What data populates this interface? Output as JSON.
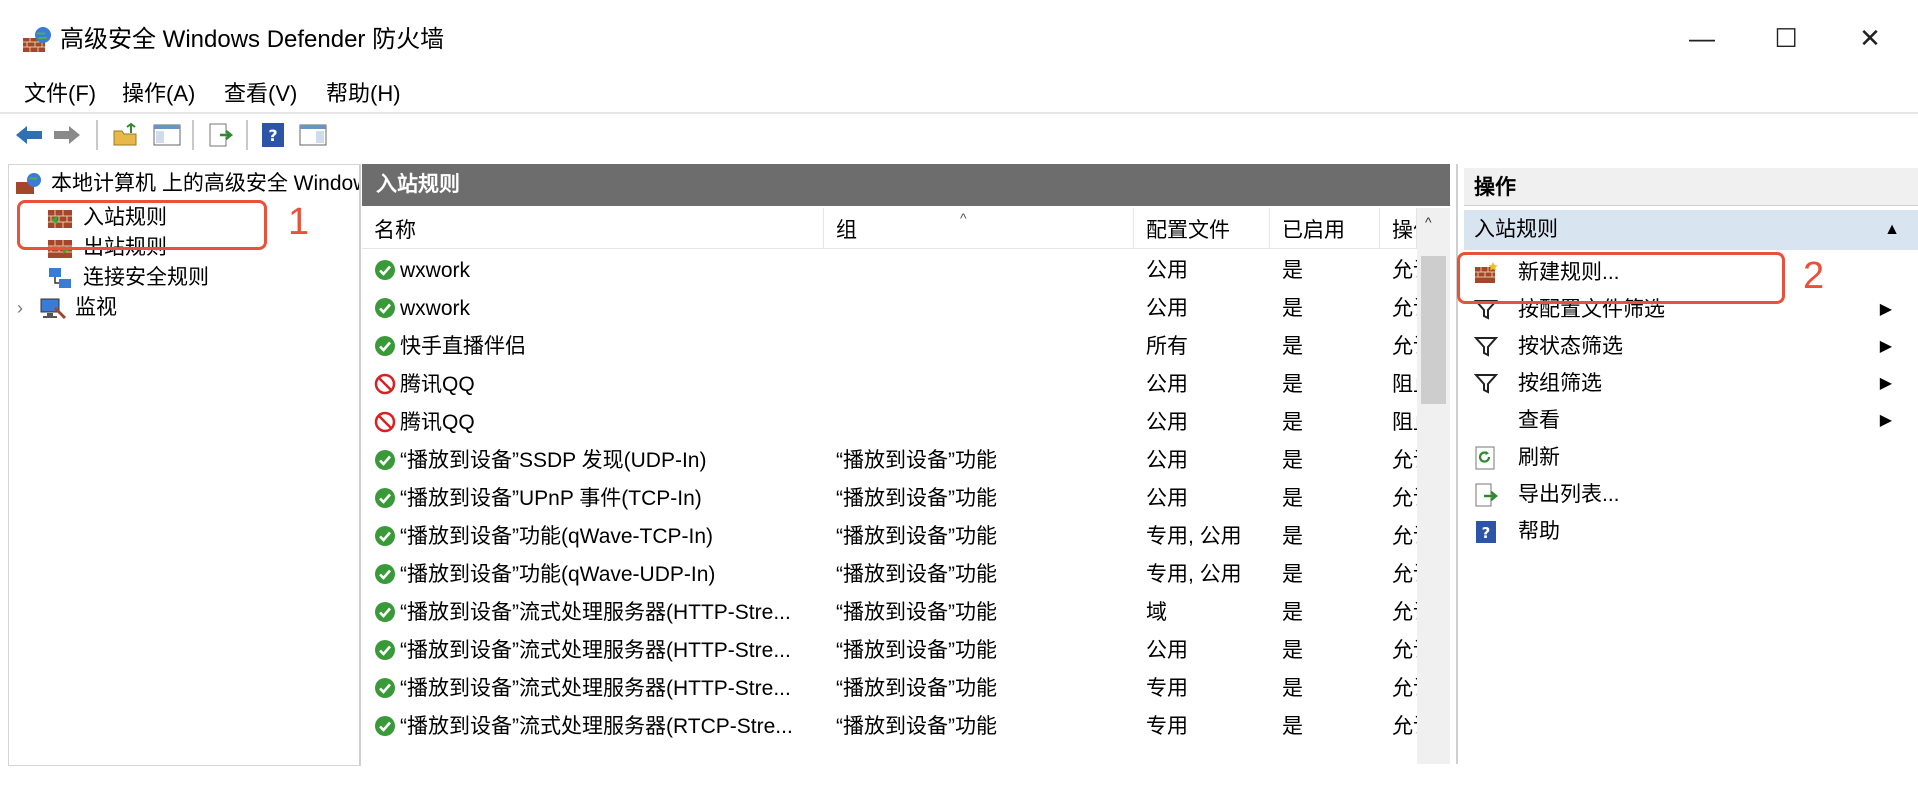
{
  "window": {
    "title": "高级安全 Windows Defender 防火墙",
    "minimize": "—",
    "maximize": "☐",
    "close": "✕"
  },
  "menu": [
    "文件(F)",
    "操作(A)",
    "查看(V)",
    "帮助(H)"
  ],
  "tree": {
    "root": "本地计算机 上的高级安全 Windows Defender 防火墙",
    "items": [
      "入站规则",
      "出站规则",
      "连接安全规则",
      "监视"
    ]
  },
  "center": {
    "header": "入站规则",
    "columns": [
      "名称",
      "组",
      "配置文件",
      "已启用",
      "操作"
    ],
    "rows": [
      {
        "status": "allow",
        "name": "wxwork",
        "group": "",
        "profile": "公用",
        "enabled": "是",
        "action": "允许"
      },
      {
        "status": "allow",
        "name": "wxwork",
        "group": "",
        "profile": "公用",
        "enabled": "是",
        "action": "允许"
      },
      {
        "status": "allow",
        "name": "快手直播伴侣",
        "group": "",
        "profile": "所有",
        "enabled": "是",
        "action": "允许"
      },
      {
        "status": "block",
        "name": "腾讯QQ",
        "group": "",
        "profile": "公用",
        "enabled": "是",
        "action": "阻止"
      },
      {
        "status": "block",
        "name": "腾讯QQ",
        "group": "",
        "profile": "公用",
        "enabled": "是",
        "action": "阻止"
      },
      {
        "status": "allow",
        "name": "“播放到设备”SSDP 发现(UDP-In)",
        "group": "“播放到设备”功能",
        "profile": "公用",
        "enabled": "是",
        "action": "允许"
      },
      {
        "status": "allow",
        "name": "“播放到设备”UPnP 事件(TCP-In)",
        "group": "“播放到设备”功能",
        "profile": "公用",
        "enabled": "是",
        "action": "允许"
      },
      {
        "status": "allow",
        "name": "“播放到设备”功能(qWave-TCP-In)",
        "group": "“播放到设备”功能",
        "profile": "专用, 公用",
        "enabled": "是",
        "action": "允许"
      },
      {
        "status": "allow",
        "name": "“播放到设备”功能(qWave-UDP-In)",
        "group": "“播放到设备”功能",
        "profile": "专用, 公用",
        "enabled": "是",
        "action": "允许"
      },
      {
        "status": "allow",
        "name": "“播放到设备”流式处理服务器(HTTP-Stre...",
        "group": "“播放到设备”功能",
        "profile": "域",
        "enabled": "是",
        "action": "允许"
      },
      {
        "status": "allow",
        "name": "“播放到设备”流式处理服务器(HTTP-Stre...",
        "group": "“播放到设备”功能",
        "profile": "公用",
        "enabled": "是",
        "action": "允许"
      },
      {
        "status": "allow",
        "name": "“播放到设备”流式处理服务器(HTTP-Stre...",
        "group": "“播放到设备”功能",
        "profile": "专用",
        "enabled": "是",
        "action": "允许"
      },
      {
        "status": "allow",
        "name": "“播放到设备”流式处理服务器(RTCP-Stre...",
        "group": "“播放到设备”功能",
        "profile": "专用",
        "enabled": "是",
        "action": "允许"
      }
    ]
  },
  "actions": {
    "header": "操作",
    "section": "入站规则",
    "items": [
      {
        "label": "新建规则...",
        "icon": "new-rule-icon",
        "submenu": false
      },
      {
        "label": "按配置文件筛选",
        "icon": "filter-icon",
        "submenu": true
      },
      {
        "label": "按状态筛选",
        "icon": "filter-icon",
        "submenu": true
      },
      {
        "label": "按组筛选",
        "icon": "filter-icon",
        "submenu": true
      },
      {
        "label": "查看",
        "icon": "",
        "submenu": true
      },
      {
        "label": "刷新",
        "icon": "refresh-icon",
        "submenu": false
      },
      {
        "label": "导出列表...",
        "icon": "export-icon",
        "submenu": false
      },
      {
        "label": "帮助",
        "icon": "help-icon",
        "submenu": false
      }
    ]
  },
  "annotations": {
    "one": "1",
    "two": "2"
  },
  "colors": {
    "accent_red": "#e8513a",
    "header_gray": "#6d6d6d",
    "section_blue": "#d9e4f1",
    "allow_green": "#3a9a3a",
    "block_red": "#d92020"
  }
}
